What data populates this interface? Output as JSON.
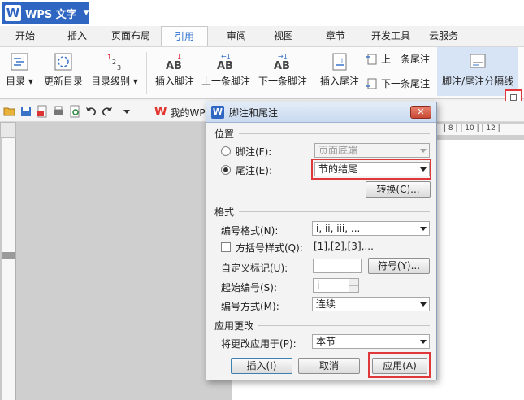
{
  "app": {
    "title": "WPS 文字",
    "logo": "W"
  },
  "tabs": [
    "开始",
    "插入",
    "页面布局",
    "引用",
    "审阅",
    "视图",
    "章节",
    "开发工具",
    "云服务"
  ],
  "ribbon": {
    "toc": "目录",
    "update_toc": "更新目录",
    "toc_level": "目录级别",
    "insert_footnote": "插入脚注",
    "prev_footnote": "上一条脚注",
    "next_footnote": "下一条脚注",
    "insert_endnote": "插入尾注",
    "prev_endnote": "上一条尾注",
    "next_endnote": "下一条尾注",
    "separator_line": "脚注/尾注分隔线"
  },
  "quick_access": {
    "doc_tab": "我的WP"
  },
  "ruler": {
    "h_ticks": "| 8 |  | 10 |  | 12 |"
  },
  "dialog": {
    "title": "脚注和尾注",
    "close": "✕",
    "position": {
      "heading": "位置",
      "footnote_label": "脚注(F):",
      "footnote_value": "页面底端",
      "endnote_label": "尾注(E):",
      "endnote_value": "节的结尾",
      "convert_button": "转换(C)..."
    },
    "format": {
      "heading": "格式",
      "number_format_label": "编号格式(N):",
      "number_format_value": "i, ii, iii, ...",
      "bracket_label": "方括号样式(Q):",
      "bracket_example": "[1],[2],[3],...",
      "custom_mark_label": "自定义标记(U):",
      "symbol_button": "符号(Y)...",
      "start_label": "起始编号(S):",
      "start_value": "i",
      "numbering_label": "编号方式(M):",
      "numbering_value": "连续"
    },
    "apply_changes": {
      "heading": "应用更改",
      "apply_to_label": "将更改应用于(P):",
      "apply_to_value": "本节"
    },
    "buttons": {
      "insert": "插入(I)",
      "cancel": "取消",
      "apply": "应用(A)"
    }
  }
}
